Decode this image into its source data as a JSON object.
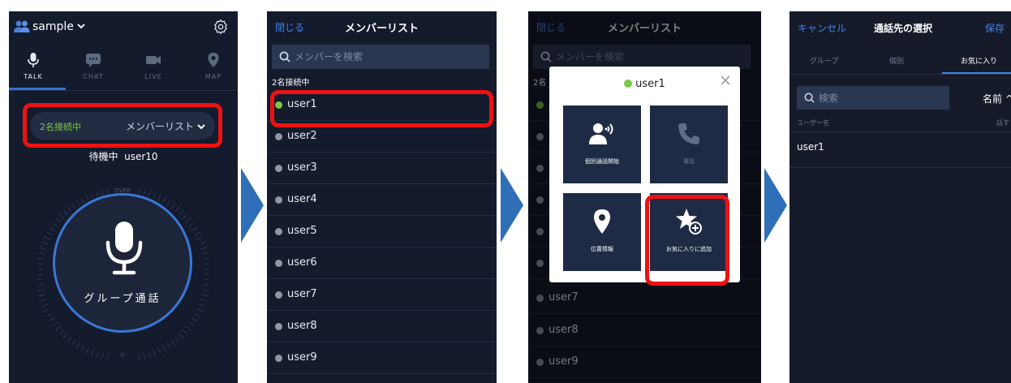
{
  "talk_screen": {
    "group_name": "sample",
    "tabs": [
      {
        "label": "TALK",
        "icon": "mic-icon"
      },
      {
        "label": "CHAT",
        "icon": "chat-bubble-icon"
      },
      {
        "label": "LIVE",
        "icon": "video-camera-icon"
      },
      {
        "label": "MAP",
        "icon": "map-pin-icon"
      }
    ],
    "active_tab": "TALK",
    "connected_status": "2名接続中",
    "member_list_button": "メンバーリスト",
    "waiting_status": "待機中",
    "current_user": "user10",
    "dial_over_label": "OVER",
    "dial_zero_label": "0",
    "ptt_label": "グループ通話"
  },
  "member_list": {
    "close_label": "閉じる",
    "title": "メンバーリスト",
    "search_placeholder": "メンバーを検索",
    "connected_count": "2名接続中",
    "users": [
      {
        "name": "user1",
        "online": true
      },
      {
        "name": "user2",
        "online": false
      },
      {
        "name": "user3",
        "online": false
      },
      {
        "name": "user4",
        "online": false
      },
      {
        "name": "user5",
        "online": false
      },
      {
        "name": "user6",
        "online": false
      },
      {
        "name": "user7",
        "online": false
      },
      {
        "name": "user8",
        "online": false
      },
      {
        "name": "user9",
        "online": false
      }
    ]
  },
  "member_list_modal": {
    "close_label": "閉じる",
    "title": "メンバーリスト",
    "search_placeholder": "メンバーを検索",
    "connected_count": "2名",
    "users": [
      "user7",
      "user8",
      "user9"
    ],
    "modal": {
      "user_name": "user1",
      "actions": [
        {
          "label": "個別通話開始",
          "icon": "person-call-icon",
          "enabled": true
        },
        {
          "label": "電話",
          "icon": "phone-icon",
          "enabled": false
        },
        {
          "label": "位置情報",
          "icon": "location-pin-icon",
          "enabled": true
        },
        {
          "label": "お気に入りに追加",
          "icon": "star-add-icon",
          "enabled": true
        }
      ]
    }
  },
  "call_select": {
    "cancel_label": "キャンセル",
    "title": "通話先の選択",
    "save_label": "保存",
    "tabs": [
      "グループ",
      "個別",
      "お気に入り"
    ],
    "active_tab": "お気に入り",
    "search_placeholder": "検索",
    "sort_label": "名前 ^",
    "column_user": "ユーザー名",
    "column_talk": "話す",
    "rows": [
      "user1"
    ]
  },
  "colors": {
    "panel_bg": "#141b2d",
    "accent_blue": "#3e83ee",
    "online_green": "#7ac943",
    "highlight_red": "#ee1111",
    "arrow_blue": "#2f6fb8"
  }
}
